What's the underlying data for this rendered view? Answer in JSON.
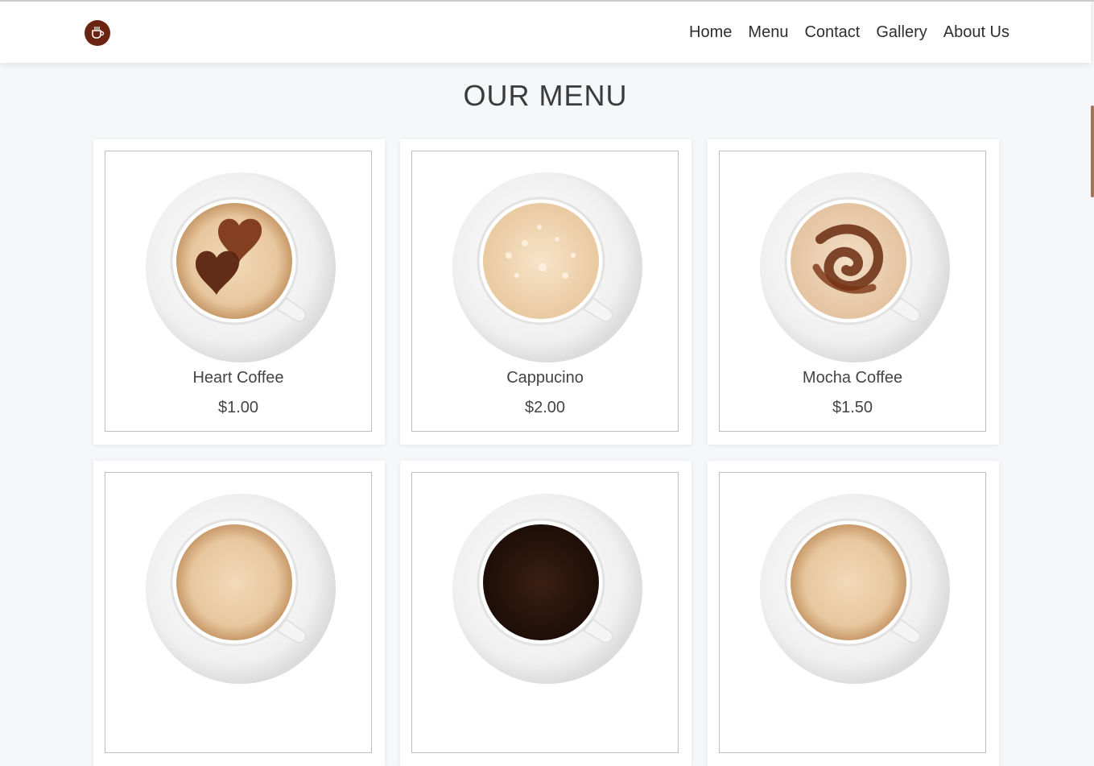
{
  "header": {
    "logo_icon": "coffee-cup-icon",
    "brand_color": "#6b2412",
    "nav": [
      "Home",
      "Menu",
      "Contact",
      "Gallery",
      "About Us"
    ]
  },
  "main": {
    "title": "OUR MENU",
    "items": [
      {
        "name": "Heart Coffee",
        "price": "$1.00",
        "art": "hearts"
      },
      {
        "name": "Cappucino",
        "price": "$2.00",
        "art": "foam"
      },
      {
        "name": "Mocha Coffee",
        "price": "$1.50",
        "art": "swirl"
      },
      {
        "art": "latte"
      },
      {
        "art": "espresso"
      },
      {
        "art": "latte"
      }
    ]
  }
}
